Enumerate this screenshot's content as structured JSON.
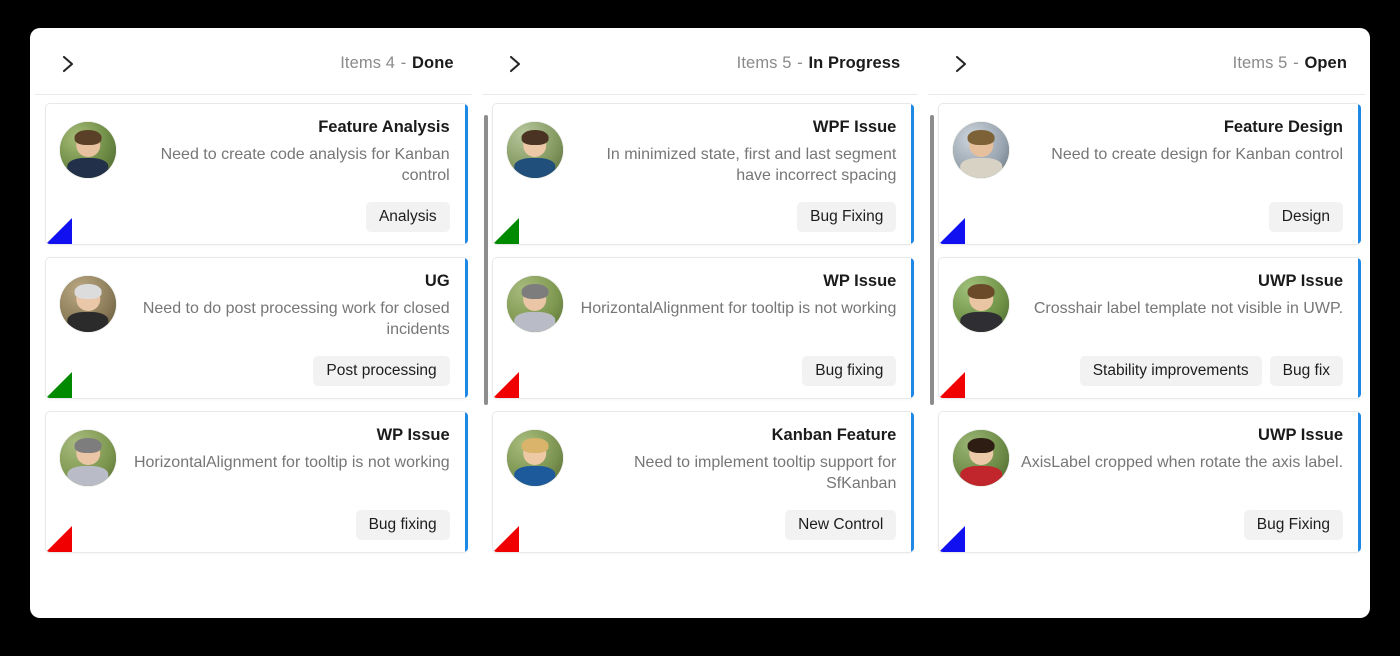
{
  "board": {
    "background_color": "#000000",
    "surface_color": "#ffffff",
    "accent_color": "#1e88e5",
    "tag_background": "#f2f2f2",
    "priority_colors": {
      "high": "#f00000",
      "normal": "#1010f0",
      "low": "#008a00"
    },
    "columns": [
      {
        "key": "Done",
        "count_label": "Items 4",
        "separator": "-",
        "expand_icon": "chevron-right-icon",
        "has_scrollbar": false,
        "cards": [
          {
            "title": "Feature Analysis",
            "description": "Need to create code analysis for Kanban control",
            "tags": [
              "Analysis"
            ],
            "priority_color": "#1010f0",
            "accent_color": "#1e88e5",
            "avatar": "avatar-man-suit"
          },
          {
            "title": "UG",
            "description": "Need to do post processing work for closed incidents",
            "tags": [
              "Post processing"
            ],
            "priority_color": "#008a00",
            "accent_color": "#1e88e5",
            "avatar": "avatar-elder-man"
          },
          {
            "title": "WP Issue",
            "description": "HorizontalAlignment for tooltip is not working",
            "tags": [
              "Bug fixing"
            ],
            "priority_color": "#f00000",
            "accent_color": "#1e88e5",
            "avatar": "avatar-woman-grey-hair"
          }
        ]
      },
      {
        "key": "In Progress",
        "count_label": "Items 5",
        "separator": "-",
        "expand_icon": "chevron-right-icon",
        "has_scrollbar": true,
        "cards": [
          {
            "title": "WPF Issue",
            "description": "In minimized state, first and last segment have incorrect spacing",
            "tags": [
              "Bug Fixing"
            ],
            "priority_color": "#008a00",
            "accent_color": "#1e88e5",
            "avatar": "avatar-woman-brown-hair"
          },
          {
            "title": "WP Issue",
            "description": "HorizontalAlignment for tooltip is not working",
            "tags": [
              "Bug fixing"
            ],
            "priority_color": "#f00000",
            "accent_color": "#1e88e5",
            "avatar": "avatar-woman-grey-hair"
          },
          {
            "title": "Kanban Feature",
            "description": "Need to implement tooltip support for SfKanban",
            "tags": [
              "New Control"
            ],
            "priority_color": "#f00000",
            "accent_color": "#1e88e5",
            "avatar": "avatar-woman-blonde"
          }
        ]
      },
      {
        "key": "Open",
        "count_label": "Items 5",
        "separator": "-",
        "expand_icon": "chevron-right-icon",
        "has_scrollbar": true,
        "cards": [
          {
            "title": "Feature Design",
            "description": "Need to create design for Kanban control",
            "tags": [
              "Design"
            ],
            "priority_color": "#1010f0",
            "accent_color": "#1e88e5",
            "avatar": "avatar-man-light-jacket"
          },
          {
            "title": "UWP Issue",
            "description": "Crosshair label template not visible in UWP.",
            "tags": [
              "Stability improvements",
              "Bug fix"
            ],
            "priority_color": "#f00000",
            "accent_color": "#1e88e5",
            "avatar": "avatar-woman-ponytail"
          },
          {
            "title": "UWP Issue",
            "description": "AxisLabel cropped when rotate the axis label.",
            "tags": [
              "Bug Fixing"
            ],
            "priority_color": "#1010f0",
            "accent_color": "#1e88e5",
            "avatar": "avatar-woman-dark-hair"
          }
        ]
      }
    ]
  }
}
